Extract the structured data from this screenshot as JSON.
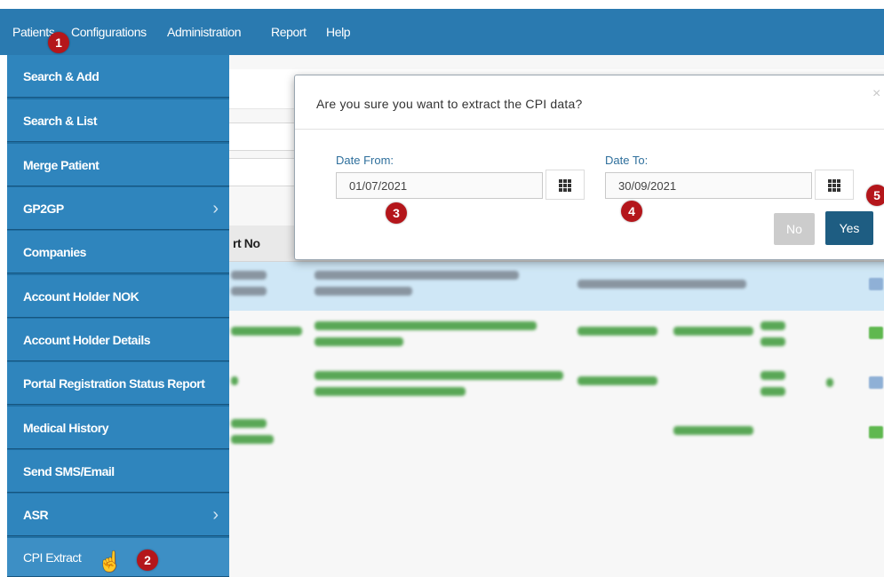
{
  "navbar": {
    "items": [
      "Patients",
      "Configurations",
      "Administration",
      "Report",
      "Help"
    ]
  },
  "menu": {
    "items": [
      {
        "label": "Search & Add",
        "has_submenu": false
      },
      {
        "label": "Search & List",
        "has_submenu": false
      },
      {
        "label": "Merge Patient",
        "has_submenu": false
      },
      {
        "label": "GP2GP",
        "has_submenu": true
      },
      {
        "label": "Companies",
        "has_submenu": false
      },
      {
        "label": "Account Holder NOK",
        "has_submenu": false
      },
      {
        "label": "Account Holder Details",
        "has_submenu": false
      },
      {
        "label": "Portal Registration Status Report",
        "has_submenu": false
      },
      {
        "label": "Medical History",
        "has_submenu": false
      },
      {
        "label": "Send SMS/Email",
        "has_submenu": false
      },
      {
        "label": "ASR",
        "has_submenu": true
      },
      {
        "label": "CPI Extract",
        "has_submenu": false
      }
    ]
  },
  "table": {
    "header_partial": "rt No"
  },
  "dialog": {
    "title": "Are you sure you want to extract the CPI data?",
    "close_icon": "×",
    "date_from_label": "Date From:",
    "date_from_value": "01/07/2021",
    "date_to_label": "Date To:",
    "date_to_value": "30/09/2021",
    "no_label": "No",
    "yes_label": "Yes"
  },
  "badges": [
    "1",
    "2",
    "3",
    "4",
    "5"
  ],
  "colors": {
    "navbar": "#2a7ab0",
    "menu_item": "#2f85bd",
    "badge": "#b4161b",
    "yes_button": "#1e5d82",
    "no_button": "#cccccc",
    "selected_row": "#cfe7f6"
  },
  "icons": {
    "chevron": "chevron-right-icon",
    "calendar": "calendar-icon",
    "cursor": "hand-pointer-icon"
  }
}
